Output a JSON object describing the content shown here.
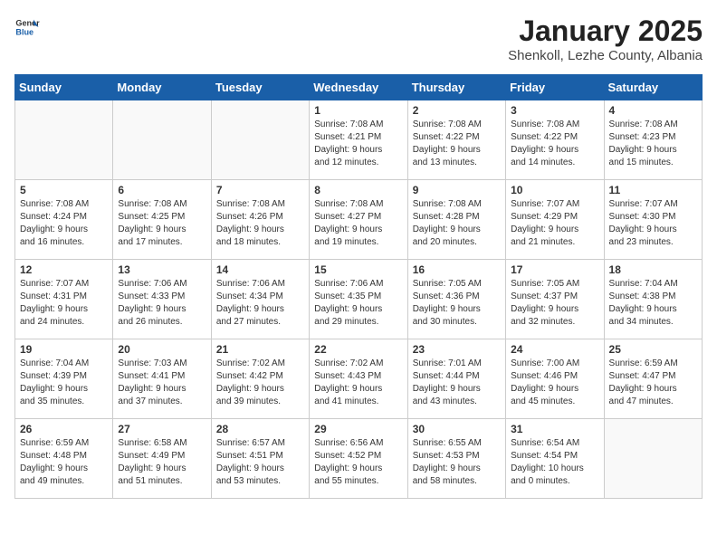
{
  "header": {
    "logo_general": "General",
    "logo_blue": "Blue",
    "title": "January 2025",
    "subtitle": "Shenkoll, Lezhe County, Albania"
  },
  "weekdays": [
    "Sunday",
    "Monday",
    "Tuesday",
    "Wednesday",
    "Thursday",
    "Friday",
    "Saturday"
  ],
  "weeks": [
    [
      {
        "day": "",
        "info": ""
      },
      {
        "day": "",
        "info": ""
      },
      {
        "day": "",
        "info": ""
      },
      {
        "day": "1",
        "info": "Sunrise: 7:08 AM\nSunset: 4:21 PM\nDaylight: 9 hours\nand 12 minutes."
      },
      {
        "day": "2",
        "info": "Sunrise: 7:08 AM\nSunset: 4:22 PM\nDaylight: 9 hours\nand 13 minutes."
      },
      {
        "day": "3",
        "info": "Sunrise: 7:08 AM\nSunset: 4:22 PM\nDaylight: 9 hours\nand 14 minutes."
      },
      {
        "day": "4",
        "info": "Sunrise: 7:08 AM\nSunset: 4:23 PM\nDaylight: 9 hours\nand 15 minutes."
      }
    ],
    [
      {
        "day": "5",
        "info": "Sunrise: 7:08 AM\nSunset: 4:24 PM\nDaylight: 9 hours\nand 16 minutes."
      },
      {
        "day": "6",
        "info": "Sunrise: 7:08 AM\nSunset: 4:25 PM\nDaylight: 9 hours\nand 17 minutes."
      },
      {
        "day": "7",
        "info": "Sunrise: 7:08 AM\nSunset: 4:26 PM\nDaylight: 9 hours\nand 18 minutes."
      },
      {
        "day": "8",
        "info": "Sunrise: 7:08 AM\nSunset: 4:27 PM\nDaylight: 9 hours\nand 19 minutes."
      },
      {
        "day": "9",
        "info": "Sunrise: 7:08 AM\nSunset: 4:28 PM\nDaylight: 9 hours\nand 20 minutes."
      },
      {
        "day": "10",
        "info": "Sunrise: 7:07 AM\nSunset: 4:29 PM\nDaylight: 9 hours\nand 21 minutes."
      },
      {
        "day": "11",
        "info": "Sunrise: 7:07 AM\nSunset: 4:30 PM\nDaylight: 9 hours\nand 23 minutes."
      }
    ],
    [
      {
        "day": "12",
        "info": "Sunrise: 7:07 AM\nSunset: 4:31 PM\nDaylight: 9 hours\nand 24 minutes."
      },
      {
        "day": "13",
        "info": "Sunrise: 7:06 AM\nSunset: 4:33 PM\nDaylight: 9 hours\nand 26 minutes."
      },
      {
        "day": "14",
        "info": "Sunrise: 7:06 AM\nSunset: 4:34 PM\nDaylight: 9 hours\nand 27 minutes."
      },
      {
        "day": "15",
        "info": "Sunrise: 7:06 AM\nSunset: 4:35 PM\nDaylight: 9 hours\nand 29 minutes."
      },
      {
        "day": "16",
        "info": "Sunrise: 7:05 AM\nSunset: 4:36 PM\nDaylight: 9 hours\nand 30 minutes."
      },
      {
        "day": "17",
        "info": "Sunrise: 7:05 AM\nSunset: 4:37 PM\nDaylight: 9 hours\nand 32 minutes."
      },
      {
        "day": "18",
        "info": "Sunrise: 7:04 AM\nSunset: 4:38 PM\nDaylight: 9 hours\nand 34 minutes."
      }
    ],
    [
      {
        "day": "19",
        "info": "Sunrise: 7:04 AM\nSunset: 4:39 PM\nDaylight: 9 hours\nand 35 minutes."
      },
      {
        "day": "20",
        "info": "Sunrise: 7:03 AM\nSunset: 4:41 PM\nDaylight: 9 hours\nand 37 minutes."
      },
      {
        "day": "21",
        "info": "Sunrise: 7:02 AM\nSunset: 4:42 PM\nDaylight: 9 hours\nand 39 minutes."
      },
      {
        "day": "22",
        "info": "Sunrise: 7:02 AM\nSunset: 4:43 PM\nDaylight: 9 hours\nand 41 minutes."
      },
      {
        "day": "23",
        "info": "Sunrise: 7:01 AM\nSunset: 4:44 PM\nDaylight: 9 hours\nand 43 minutes."
      },
      {
        "day": "24",
        "info": "Sunrise: 7:00 AM\nSunset: 4:46 PM\nDaylight: 9 hours\nand 45 minutes."
      },
      {
        "day": "25",
        "info": "Sunrise: 6:59 AM\nSunset: 4:47 PM\nDaylight: 9 hours\nand 47 minutes."
      }
    ],
    [
      {
        "day": "26",
        "info": "Sunrise: 6:59 AM\nSunset: 4:48 PM\nDaylight: 9 hours\nand 49 minutes."
      },
      {
        "day": "27",
        "info": "Sunrise: 6:58 AM\nSunset: 4:49 PM\nDaylight: 9 hours\nand 51 minutes."
      },
      {
        "day": "28",
        "info": "Sunrise: 6:57 AM\nSunset: 4:51 PM\nDaylight: 9 hours\nand 53 minutes."
      },
      {
        "day": "29",
        "info": "Sunrise: 6:56 AM\nSunset: 4:52 PM\nDaylight: 9 hours\nand 55 minutes."
      },
      {
        "day": "30",
        "info": "Sunrise: 6:55 AM\nSunset: 4:53 PM\nDaylight: 9 hours\nand 58 minutes."
      },
      {
        "day": "31",
        "info": "Sunrise: 6:54 AM\nSunset: 4:54 PM\nDaylight: 10 hours\nand 0 minutes."
      },
      {
        "day": "",
        "info": ""
      }
    ]
  ]
}
